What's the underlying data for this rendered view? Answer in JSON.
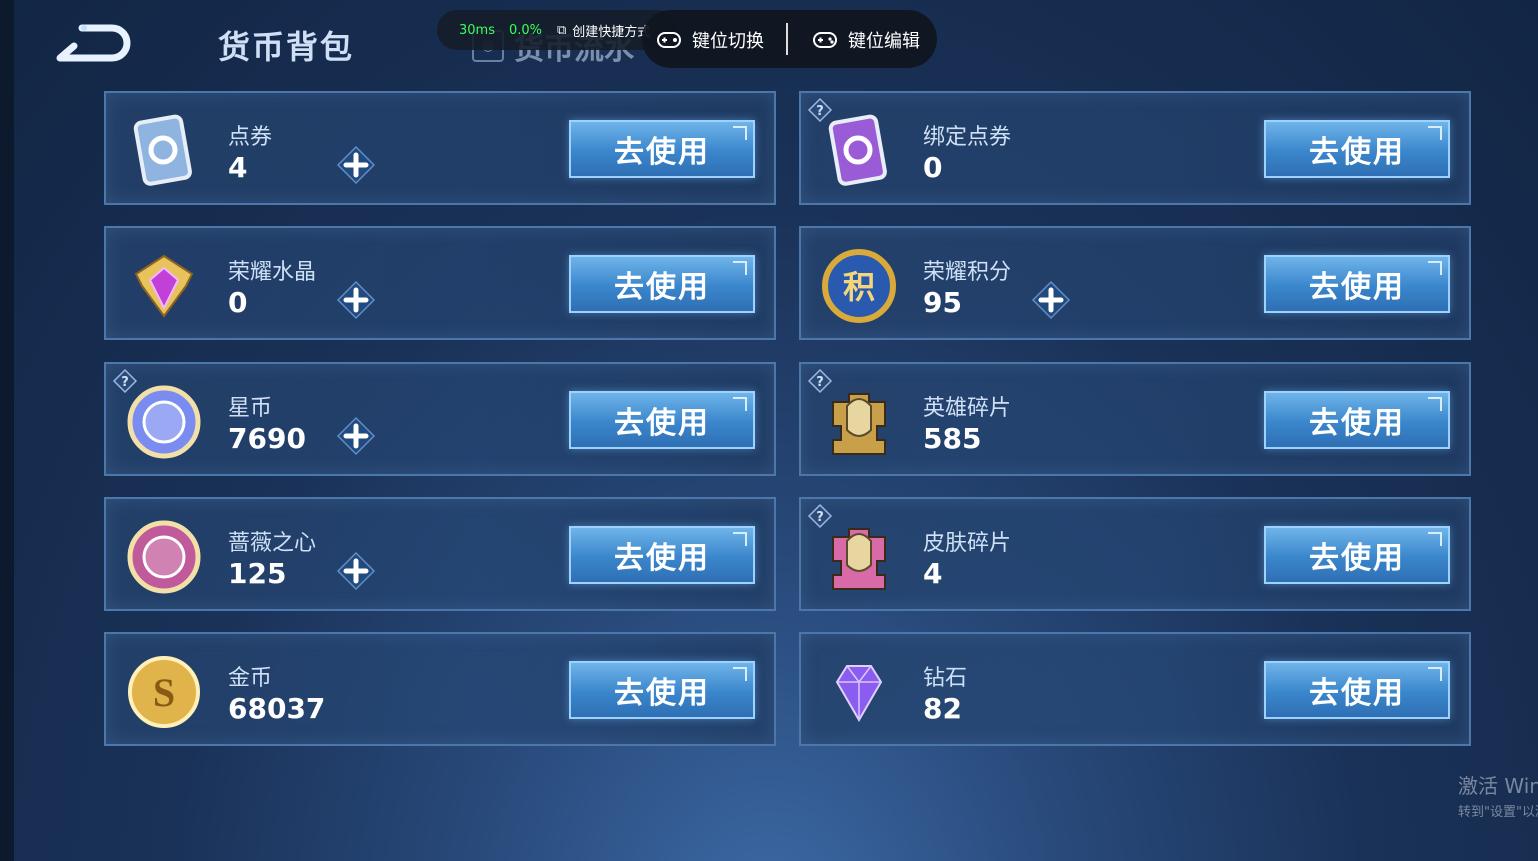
{
  "header": {
    "title": "货币背包",
    "tab_label": "货币流水"
  },
  "overlay": {
    "latency": "30ms",
    "cpu": "0.0%",
    "shortcut": "创建快捷方式",
    "keyswitch": "键位切换",
    "keyedit": "键位编辑"
  },
  "use_label": "去使用",
  "currencies": [
    {
      "name": "点券",
      "amount": "4",
      "has_plus": true,
      "has_help": false,
      "icon": "coupon-icon",
      "color": "#8fb4e0"
    },
    {
      "name": "绑定点券",
      "amount": "0",
      "has_plus": false,
      "has_help": true,
      "icon": "bound-coupon-icon",
      "color": "#9a5cd6"
    },
    {
      "name": "荣耀水晶",
      "amount": "0",
      "has_plus": true,
      "has_help": false,
      "icon": "glory-crystal-icon",
      "color": "#c040d8"
    },
    {
      "name": "荣耀积分",
      "amount": "95",
      "has_plus": true,
      "has_help": false,
      "icon": "glory-points-icon",
      "color": "#d9a93a"
    },
    {
      "name": "星币",
      "amount": "7690",
      "has_plus": true,
      "has_help": true,
      "icon": "star-coin-icon",
      "color": "#7a8cf0"
    },
    {
      "name": "英雄碎片",
      "amount": "585",
      "has_plus": false,
      "has_help": true,
      "icon": "hero-fragment-icon",
      "color": "#c9a04a"
    },
    {
      "name": "蔷薇之心",
      "amount": "125",
      "has_plus": true,
      "has_help": false,
      "icon": "rose-heart-icon",
      "color": "#c05a9a"
    },
    {
      "name": "皮肤碎片",
      "amount": "4",
      "has_plus": false,
      "has_help": true,
      "icon": "skin-fragment-icon",
      "color": "#d86aa8"
    },
    {
      "name": "金币",
      "amount": "68037",
      "has_plus": false,
      "has_help": false,
      "icon": "gold-coin-icon",
      "color": "#e0b44a"
    },
    {
      "name": "钻石",
      "amount": "82",
      "has_plus": false,
      "has_help": false,
      "icon": "diamond-icon",
      "color": "#8a5cf0"
    }
  ],
  "watermark": {
    "line1": "激活 Windows",
    "line2": "转到\"设置\"以激活 Windows。"
  }
}
